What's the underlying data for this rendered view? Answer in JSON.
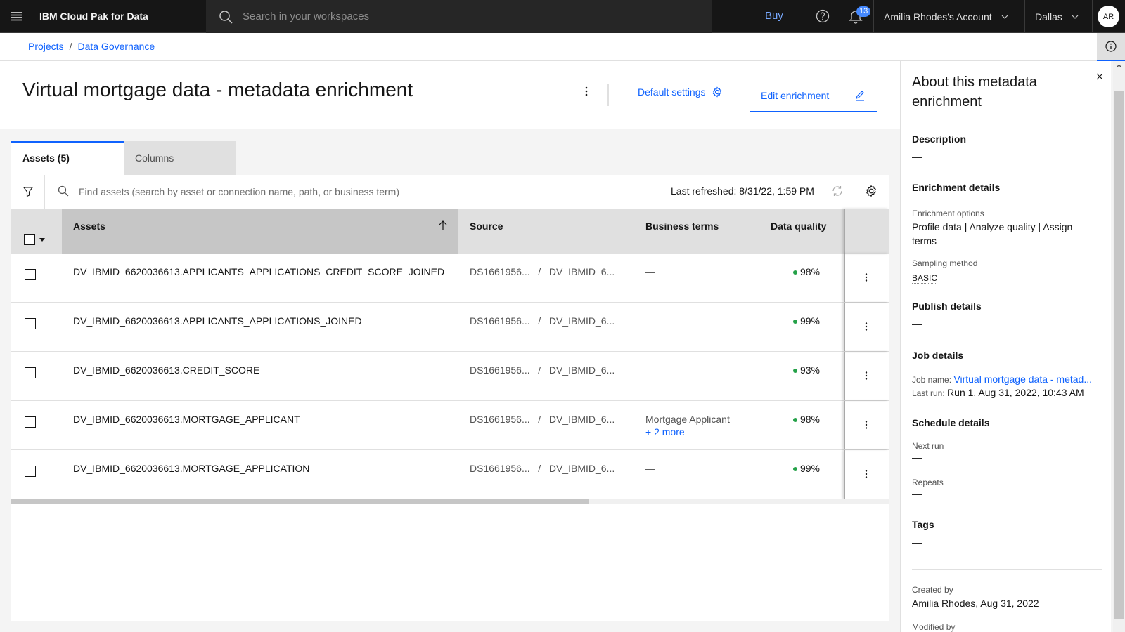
{
  "header": {
    "app_name": "IBM Cloud Pak for Data",
    "search_placeholder": "Search in your workspaces",
    "buy_label": "Buy",
    "notification_count": "13",
    "account_label": "Amilia Rhodes's Account",
    "region_label": "Dallas",
    "avatar_initials": "AR"
  },
  "breadcrumb": {
    "items": [
      "Projects",
      "Data Governance"
    ],
    "separator": "/"
  },
  "page": {
    "title": "Virtual mortgage data - metadata enrichment",
    "default_settings_label": "Default settings",
    "edit_enrichment_label": "Edit enrichment"
  },
  "tabs": [
    {
      "label": "Assets (5)",
      "active": true
    },
    {
      "label": "Columns",
      "active": false
    }
  ],
  "toolbar": {
    "search_placeholder": "Find assets (search by asset or connection name, path, or business term)",
    "last_refreshed": "Last refreshed: 8/31/22, 1:59 PM"
  },
  "table": {
    "columns": [
      "Assets",
      "Source",
      "Business terms",
      "Data quality"
    ],
    "sort": {
      "column": "Assets",
      "direction": "ascending"
    },
    "rows": [
      {
        "asset": "DV_IBMID_6620036613.APPLICANTS_APPLICATIONS_CREDIT_SCORE_JOINED",
        "source_a": "DS1661956...",
        "source_b": "DV_IBMID_6...",
        "terms": "—",
        "terms_more": "",
        "quality": "98%"
      },
      {
        "asset": "DV_IBMID_6620036613.APPLICANTS_APPLICATIONS_JOINED",
        "source_a": "DS1661956...",
        "source_b": "DV_IBMID_6...",
        "terms": "—",
        "terms_more": "",
        "quality": "99%"
      },
      {
        "asset": "DV_IBMID_6620036613.CREDIT_SCORE",
        "source_a": "DS1661956...",
        "source_b": "DV_IBMID_6...",
        "terms": "—",
        "terms_more": "",
        "quality": "93%"
      },
      {
        "asset": "DV_IBMID_6620036613.MORTGAGE_APPLICANT",
        "source_a": "DS1661956...",
        "source_b": "DV_IBMID_6...",
        "terms": "Mortgage Applicant",
        "terms_more": "+ 2 more",
        "quality": "98%"
      },
      {
        "asset": "DV_IBMID_6620036613.MORTGAGE_APPLICATION",
        "source_a": "DS1661956...",
        "source_b": "DV_IBMID_6...",
        "terms": "—",
        "terms_more": "",
        "quality": "99%"
      }
    ],
    "source_separator": "/",
    "horizontal_scroll_visible_fraction": 0.66
  },
  "panel": {
    "title": "About this metadata enrichment",
    "description_heading": "Description",
    "description_value": "—",
    "enrichment_heading": "Enrichment details",
    "enrichment_options_label": "Enrichment options",
    "enrichment_options_value": "Profile data | Analyze quality | Assign terms",
    "sampling_label": "Sampling method",
    "sampling_value": "BASIC",
    "publish_heading": "Publish details",
    "publish_value": "—",
    "job_heading": "Job details",
    "job_name_label": "Job name:",
    "job_name_value": "Virtual mortgage data - metad...",
    "last_run_label": "Last run:",
    "last_run_value": "Run 1, Aug 31, 2022, 10:43 AM",
    "schedule_heading": "Schedule details",
    "next_run_label": "Next run",
    "next_run_value": "—",
    "repeats_label": "Repeats",
    "repeats_value": "—",
    "tags_heading": "Tags",
    "tags_value": "—",
    "created_by_label": "Created by",
    "created_by_value": "Amilia Rhodes, Aug 31, 2022",
    "modified_by_label": "Modified by"
  },
  "colors": {
    "accent": "#0f62fe",
    "header_bg": "#161616",
    "quality_good": "#24a148"
  }
}
